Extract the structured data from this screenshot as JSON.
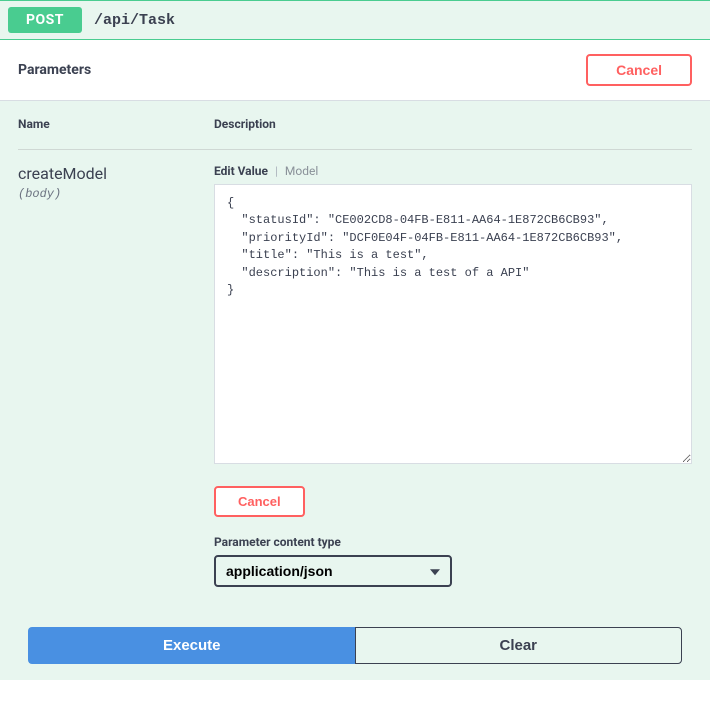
{
  "endpoint": {
    "method": "POST",
    "path": "/api/Task"
  },
  "parametersBar": {
    "title": "Parameters",
    "cancel_label": "Cancel"
  },
  "columns": {
    "name": "Name",
    "description": "Description"
  },
  "parameter": {
    "name": "createModel",
    "in": "(body)"
  },
  "editor": {
    "tab_edit": "Edit Value",
    "tab_model": "Model",
    "body_value": "{\n  \"statusId\": \"CE002CD8-04FB-E811-AA64-1E872CB6CB93\",\n  \"priorityId\": \"DCF0E04F-04FB-E811-AA64-1E872CB6CB93\",\n  \"title\": \"This is a test\",\n  \"description\": \"This is a test of a API\"\n}",
    "cancel_label": "Cancel",
    "content_type_label": "Parameter content type",
    "content_type_value": "application/json"
  },
  "actions": {
    "execute": "Execute",
    "clear": "Clear"
  }
}
